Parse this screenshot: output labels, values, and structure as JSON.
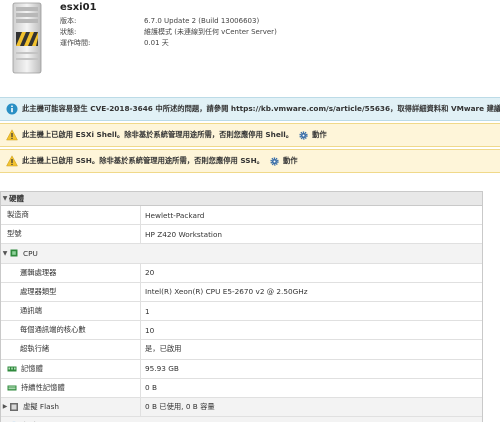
{
  "host": {
    "name": "esxi01",
    "info": [
      {
        "label": "版本:",
        "value": "6.7.0 Update 2 (Build 13006603)"
      },
      {
        "label": "狀態:",
        "value": "維護模式 (未連線到任何 vCenter Server)"
      },
      {
        "label": "運作時間:",
        "value": "0.01 天"
      }
    ]
  },
  "alerts": {
    "cve": {
      "icon": "info-icon",
      "text": "此主機可能容易發生 CVE-2018-3646 中所述的問題，請參閱 https://kb.vmware.com/s/article/55636，取得詳細資料和 VMware 建議。"
    },
    "esxi_shell": {
      "icon": "warning-icon",
      "text": "此主機上已啟用 ESXi Shell。除非基於系統管理用途所需，否則您應停用 Shell。",
      "action_label": "動作"
    },
    "ssh": {
      "icon": "warning-icon",
      "text": "此主機上已啟用 SSH。除非基於系統管理用途所需，否則您應停用 SSH。",
      "action_label": "動作"
    }
  },
  "hardware": {
    "title": "硬體",
    "manufacturer": {
      "label": "製造商",
      "value": "Hewlett-Packard"
    },
    "model": {
      "label": "型號",
      "value": "HP Z420 Workstation"
    },
    "cpu": {
      "label": "CPU",
      "rows": [
        {
          "label": "邏輯處理器",
          "value": "20"
        },
        {
          "label": "處理器類型",
          "value": "Intel(R) Xeon(R) CPU E5-2670 v2 @ 2.50GHz"
        },
        {
          "label": "通訊端",
          "value": "1"
        },
        {
          "label": "每個通訊端的核心數",
          "value": "10"
        },
        {
          "label": "超執行緒",
          "value": "是，已啟用"
        }
      ]
    },
    "memory": {
      "label": "記憶體",
      "value": "95.93 GB"
    },
    "persistent_memory": {
      "label": "持續性記憶體",
      "value": "0 B"
    },
    "virtual_flash": {
      "label": "虛擬 Flash",
      "value": "0 B 已使用, 0 B 容量"
    },
    "network": {
      "label": "網路"
    }
  },
  "colors": {
    "info_bg": "#e1f1f6",
    "warn_bg": "#fef5d9",
    "section_bg": "#f3f3f3",
    "info_blue": "#2a8fc4",
    "warn_yellow": "#f2c230"
  }
}
